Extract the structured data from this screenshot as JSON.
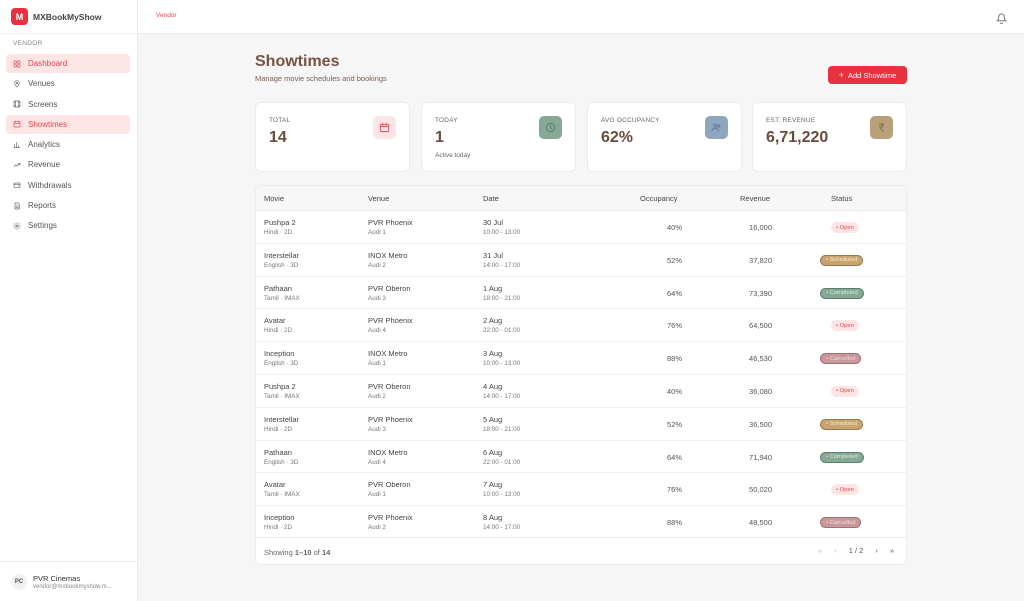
{
  "brand": {
    "logo_letter": "M",
    "name": "MXBookMyShow"
  },
  "sidebar": {
    "section_label": "VENDOR",
    "items": [
      {
        "label": "Dashboard",
        "icon": "dashboard-icon",
        "active": true
      },
      {
        "label": "Venues",
        "icon": "pin-icon",
        "active": false
      },
      {
        "label": "Screens",
        "icon": "film-icon",
        "active": false
      },
      {
        "label": "Showtimes",
        "icon": "calendar-icon",
        "active": true
      },
      {
        "label": "Analytics",
        "icon": "bar-chart-icon",
        "active": false
      },
      {
        "label": "Revenue",
        "icon": "trend-icon",
        "active": false
      },
      {
        "label": "Withdrawals",
        "icon": "wallet-icon",
        "active": false
      },
      {
        "label": "Reports",
        "icon": "document-icon",
        "active": false
      },
      {
        "label": "Settings",
        "icon": "gear-icon",
        "active": false
      }
    ],
    "user": {
      "initials": "PC",
      "name": "PVR Cinemas",
      "email": "vendor@mxbookmyshow.m..."
    }
  },
  "topbar": {
    "breadcrumb": "Vendor"
  },
  "header": {
    "title": "Showtimes",
    "subtitle": "Manage movie schedules and bookings",
    "add_button": "Add Showtime"
  },
  "stats": [
    {
      "label": "TOTAL",
      "value": "14",
      "sub": "",
      "icon": "calendar-icon",
      "icon_bg": "#fde4e5"
    },
    {
      "label": "TODAY",
      "value": "1",
      "sub": "Active today",
      "icon": "clock-icon",
      "icon_bg": "#86a897"
    },
    {
      "label": "AVG OCCUPANCY",
      "value": "62%",
      "sub": "",
      "icon": "users-icon",
      "icon_bg": "#8fa6bf"
    },
    {
      "label": "EST. REVENUE",
      "value": "6,71,220",
      "sub": "",
      "icon": "rupee-icon",
      "icon_bg": "#b9a07a"
    }
  ],
  "table": {
    "headers": {
      "movie": "Movie",
      "venue": "Venue",
      "date": "Date",
      "occupancy": "Occupancy",
      "revenue": "Revenue",
      "status": "Status"
    },
    "rows": [
      {
        "movie": "Pushpa 2",
        "format": "Hindi · 2D",
        "venue": "PVR Phoenix",
        "screen": "Audi 1",
        "date": "30 Jul",
        "time": "10:00 - 13:00",
        "occupancy": "40%",
        "revenue": "16,000",
        "status": "• Open",
        "status_type": "open"
      },
      {
        "movie": "Interstellar",
        "format": "English · 3D",
        "venue": "INOX Metro",
        "screen": "Audi 2",
        "date": "31 Jul",
        "time": "14:00 - 17:00",
        "occupancy": "52%",
        "revenue": "37,820",
        "status": "• Scheduled",
        "status_type": "scheduled"
      },
      {
        "movie": "Pathaan",
        "format": "Tamil · IMAX",
        "venue": "PVR Oberon",
        "screen": "Audi 3",
        "date": "1 Aug",
        "time": "18:00 - 21:00",
        "occupancy": "64%",
        "revenue": "73,390",
        "status": "• Completed",
        "status_type": "completed"
      },
      {
        "movie": "Avatar",
        "format": "Hindi · 2D",
        "venue": "PVR Phoenix",
        "screen": "Audi 4",
        "date": "2 Aug",
        "time": "22:00 - 01:00",
        "occupancy": "76%",
        "revenue": "64,500",
        "status": "• Open",
        "status_type": "open"
      },
      {
        "movie": "Inception",
        "format": "English · 3D",
        "venue": "INOX Metro",
        "screen": "Audi 1",
        "date": "3 Aug",
        "time": "10:00 - 13:00",
        "occupancy": "88%",
        "revenue": "46,530",
        "status": "• Cancelled",
        "status_type": "cancelled"
      },
      {
        "movie": "Pushpa 2",
        "format": "Tamil · IMAX",
        "venue": "PVR Oberon",
        "screen": "Audi 2",
        "date": "4 Aug",
        "time": "14:00 - 17:00",
        "occupancy": "40%",
        "revenue": "36,080",
        "status": "• Open",
        "status_type": "open"
      },
      {
        "movie": "Interstellar",
        "format": "Hindi · 2D",
        "venue": "PVR Phoenix",
        "screen": "Audi 3",
        "date": "5 Aug",
        "time": "18:00 - 21:00",
        "occupancy": "52%",
        "revenue": "36,500",
        "status": "• Scheduled",
        "status_type": "scheduled"
      },
      {
        "movie": "Pathaan",
        "format": "English · 3D",
        "venue": "INOX Metro",
        "screen": "Audi 4",
        "date": "6 Aug",
        "time": "22:00 - 01:00",
        "occupancy": "64%",
        "revenue": "71,940",
        "status": "• Completed",
        "status_type": "completed"
      },
      {
        "movie": "Avatar",
        "format": "Tamil · IMAX",
        "venue": "PVR Oberon",
        "screen": "Audi 1",
        "date": "7 Aug",
        "time": "10:00 - 13:00",
        "occupancy": "76%",
        "revenue": "50,020",
        "status": "• Open",
        "status_type": "open"
      },
      {
        "movie": "Inception",
        "format": "Hindi · 2D",
        "venue": "PVR Phoenix",
        "screen": "Audi 2",
        "date": "8 Aug",
        "time": "14:00 - 17:00",
        "occupancy": "88%",
        "revenue": "48,500",
        "status": "• Cancelled",
        "status_type": "cancelled"
      }
    ],
    "footer": {
      "showing_prefix": "Showing ",
      "showing_range": "1–10",
      "showing_of": " of ",
      "showing_total": "14",
      "first": "«",
      "prev": "‹",
      "page": "1 / 2",
      "next": "›",
      "last": "»"
    }
  }
}
